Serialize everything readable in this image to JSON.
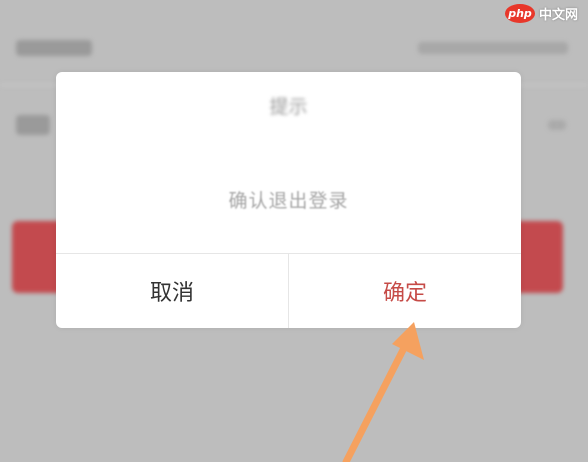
{
  "dialog": {
    "title": "提示",
    "message": "确认退出登录",
    "cancel_label": "取消",
    "confirm_label": "确定"
  },
  "watermark": {
    "logo_text": "php",
    "site_text": "中文网"
  },
  "colors": {
    "confirm_text": "#c64b47",
    "background_logout_button": "#c34a4e",
    "annotation_arrow": "#f5a15f"
  }
}
